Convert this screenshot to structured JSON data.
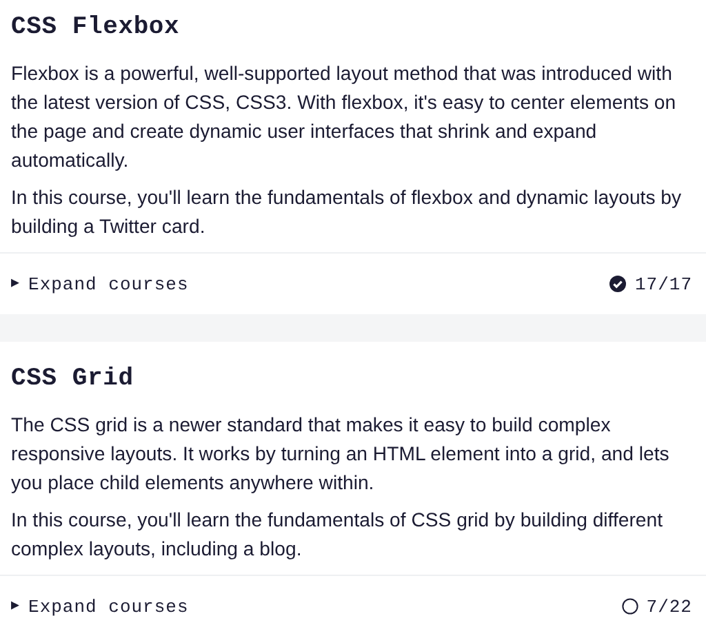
{
  "courses": [
    {
      "title": "CSS Flexbox",
      "paragraphs": [
        "Flexbox is a powerful, well-supported layout method that was introduced with the latest version of CSS, CSS3. With flexbox, it's easy to center elements on the page and create dynamic user interfaces that shrink and expand automatically.",
        "In this course, you'll learn the fundamentals of flexbox and dynamic layouts by building a Twitter card."
      ],
      "toggle": "▶",
      "expand_label": "Expand courses",
      "completed": true,
      "progress": "17/17"
    },
    {
      "title": "CSS Grid",
      "paragraphs": [
        "The CSS grid is a newer standard that makes it easy to build complex responsive layouts. It works by turning an HTML element into a grid, and lets you place child elements anywhere within.",
        "In this course, you'll learn the fundamentals of CSS grid by building different complex layouts, including a blog."
      ],
      "toggle": "▶",
      "expand_label": "Expand courses",
      "completed": false,
      "progress": "7/22"
    }
  ]
}
